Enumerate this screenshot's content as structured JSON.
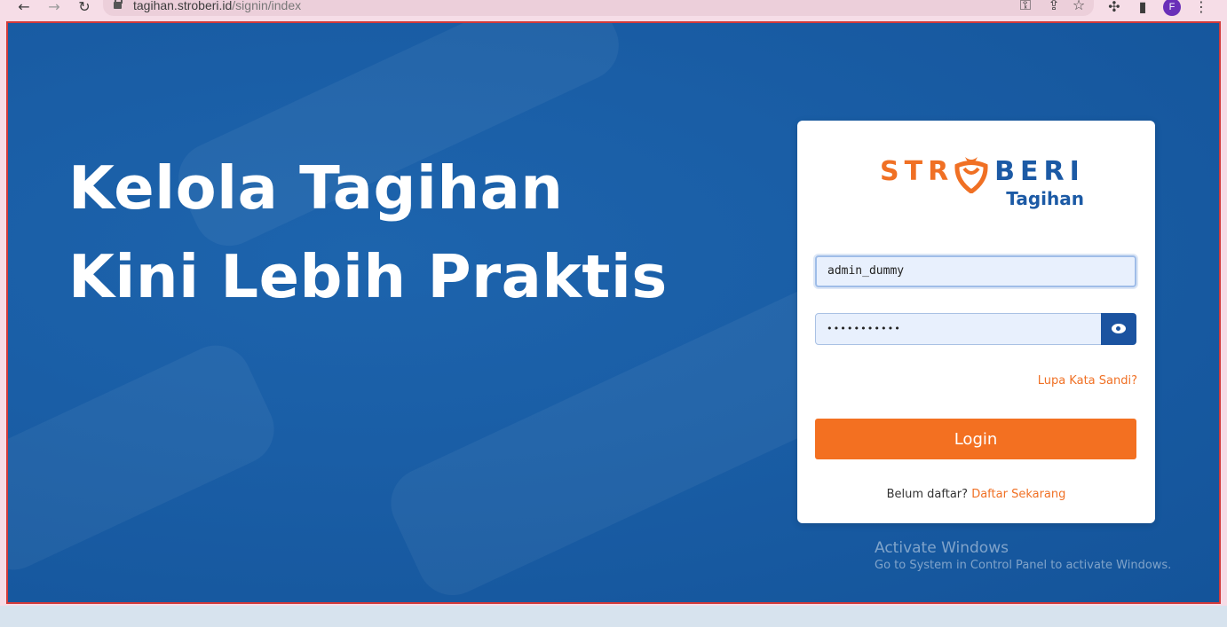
{
  "browser": {
    "url_host": "tagihan.stroberi.id",
    "url_path": "/signin/index",
    "profile_initial": "F"
  },
  "hero": {
    "line1": "Kelola Tagihan",
    "line2": "Kini Lebih Praktis"
  },
  "logo": {
    "word_left": "STR",
    "word_right": "BERI",
    "sub": "Tagihan"
  },
  "form": {
    "username_value": "admin_dummy",
    "password_masked": "•••••••••••",
    "forgot_label": "Lupa Kata Sandi?",
    "login_label": "Login",
    "register_prompt": "Belum daftar?",
    "register_link": "Daftar Sekarang"
  },
  "watermark": {
    "title": "Activate Windows",
    "subtitle": "Go to System in Control Panel to activate Windows."
  },
  "colors": {
    "primary_blue": "#1c5aa5",
    "accent_orange": "#f37021",
    "page_bg": "#1a5ea6"
  }
}
